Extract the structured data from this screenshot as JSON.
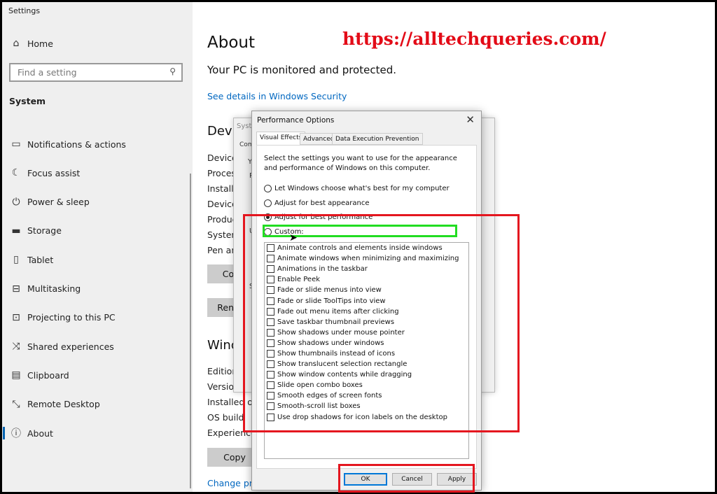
{
  "app_title": "Settings",
  "sidebar": {
    "home": "Home",
    "search_placeholder": "Find a setting",
    "section": "System",
    "items": [
      {
        "label": "Notifications & actions",
        "icon": "notification-icon"
      },
      {
        "label": "Focus assist",
        "icon": "moon-icon"
      },
      {
        "label": "Power & sleep",
        "icon": "power-icon"
      },
      {
        "label": "Storage",
        "icon": "storage-icon"
      },
      {
        "label": "Tablet",
        "icon": "tablet-icon"
      },
      {
        "label": "Multitasking",
        "icon": "multitasking-icon"
      },
      {
        "label": "Projecting to this PC",
        "icon": "projector-icon"
      },
      {
        "label": "Shared experiences",
        "icon": "shared-icon"
      },
      {
        "label": "Clipboard",
        "icon": "clipboard-icon"
      },
      {
        "label": "Remote Desktop",
        "icon": "remote-icon"
      },
      {
        "label": "About",
        "icon": "info-icon",
        "selected": true
      }
    ]
  },
  "main": {
    "title": "About",
    "status": "Your PC is monitored and protected.",
    "security_link": "See details in Windows Security",
    "device_heading": "Devic",
    "device_labels": [
      "Device",
      "Proces",
      "Installe",
      "Device",
      "Produc",
      "System",
      "Pen an"
    ],
    "copy_btn1": "Co",
    "rename_btn": "Rena",
    "windows_heading": "Winc",
    "windows_labels": [
      "Edition",
      "Versior",
      "Installed on",
      "OS build",
      "Experience"
    ],
    "copy_btn2": "Copy",
    "change_link": "Change pro"
  },
  "watermark": "https://alltechqueries.com/",
  "system_dialog": {
    "title": "Syste",
    "tab": "Com",
    "frag1": "Y",
    "frag2": "P",
    "frag3": "U",
    "frag4": "S"
  },
  "perf_dialog": {
    "title": "Performance Options",
    "tabs": [
      "Visual Effects",
      "Advanced",
      "Data Execution Prevention"
    ],
    "active_tab": "Visual Effects",
    "description": "Select the settings you want to use for the appearance and performance of Windows on this computer.",
    "options": [
      {
        "label": "Let Windows choose what's best for my computer",
        "selected": false
      },
      {
        "label": "Adjust for best appearance",
        "selected": false
      },
      {
        "label": "Adjust for best performance",
        "selected": true
      },
      {
        "label": "Custom:",
        "selected": false
      }
    ],
    "effects": [
      "Animate controls and elements inside windows",
      "Animate windows when minimizing and maximizing",
      "Animations in the taskbar",
      "Enable Peek",
      "Fade or slide menus into view",
      "Fade or slide ToolTips into view",
      "Fade out menu items after clicking",
      "Save taskbar thumbnail previews",
      "Show shadows under mouse pointer",
      "Show shadows under windows",
      "Show thumbnails instead of icons",
      "Show translucent selection rectangle",
      "Show window contents while dragging",
      "Slide open combo boxes",
      "Smooth edges of screen fonts",
      "Smooth-scroll list boxes",
      "Use drop shadows for icon labels on the desktop"
    ],
    "ok": "OK",
    "cancel": "Cancel",
    "apply": "Apply"
  },
  "colors": {
    "highlight_red": "#e4161f",
    "highlight_green": "#22dd22",
    "accent": "#0067c0"
  }
}
